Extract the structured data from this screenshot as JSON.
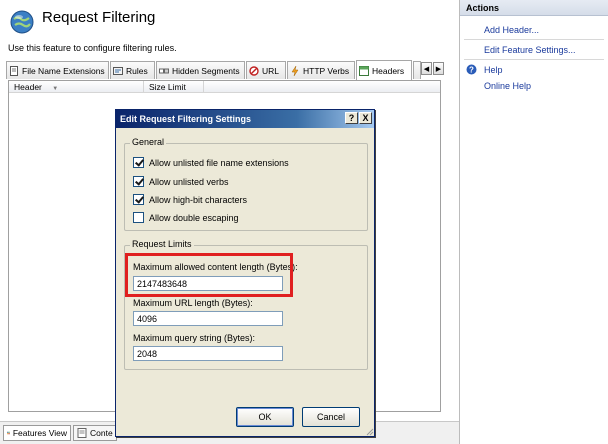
{
  "page": {
    "title": "Request Filtering",
    "description": "Use this feature to configure filtering rules."
  },
  "tabs": [
    {
      "label": "File Name Extensions",
      "icon": "file-extension-icon",
      "active": false
    },
    {
      "label": "Rules",
      "icon": "rules-icon",
      "active": false
    },
    {
      "label": "Hidden Segments",
      "icon": "hidden-segments-icon",
      "active": false
    },
    {
      "label": "URL",
      "icon": "url-icon",
      "active": false
    },
    {
      "label": "HTTP Verbs",
      "icon": "http-verbs-icon",
      "active": false
    },
    {
      "label": "Headers",
      "icon": "headers-icon",
      "active": true
    }
  ],
  "list": {
    "columns": [
      "Header",
      "Size Limit"
    ]
  },
  "bottom_tabs": [
    {
      "label": "Features View",
      "icon": "features-view-icon",
      "active": true
    },
    {
      "label": "Conte",
      "icon": "content-view-icon",
      "active": false
    }
  ],
  "actions": {
    "header": "Actions",
    "add_header": "Add Header...",
    "edit_feature_settings": "Edit Feature Settings...",
    "help": "Help",
    "online_help": "Online Help"
  },
  "dialog": {
    "title": "Edit Request Filtering Settings",
    "help_button": "?",
    "close_button": "X",
    "general": {
      "label": "General",
      "options": [
        {
          "label": "Allow unlisted file name extensions",
          "checked": true
        },
        {
          "label": "Allow unlisted verbs",
          "checked": true
        },
        {
          "label": "Allow high-bit characters",
          "checked": true
        },
        {
          "label": "Allow double escaping",
          "checked": false
        }
      ]
    },
    "limits": {
      "label": "Request Limits",
      "max_content_length_label": "Maximum allowed content length (Bytes):",
      "max_content_length": "2147483648",
      "max_url_length_label": "Maximum URL length (Bytes):",
      "max_url_length": "4096",
      "max_query_string_label": "Maximum query string (Bytes):",
      "max_query_string": "2048"
    },
    "ok_label": "OK",
    "cancel_label": "Cancel"
  },
  "colors": {
    "highlight": "#e02020",
    "link": "#1a3a9c",
    "dialog_titlebar": "#0a246a"
  }
}
